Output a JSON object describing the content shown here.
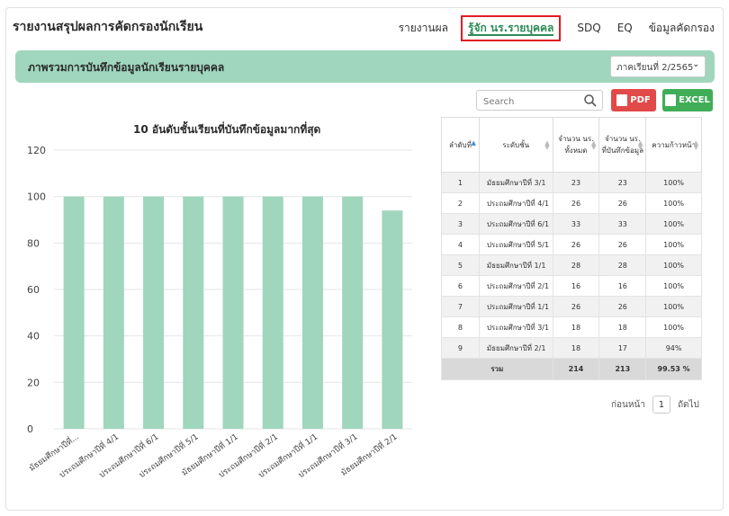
{
  "header": {
    "app_title": "รายงานสรุปผลการคัดกรองนักเรียน",
    "nav": [
      {
        "label": "รายงานผล",
        "active": false
      },
      {
        "label": "รู้จัก นร.รายบุคคล",
        "active": true
      },
      {
        "label": "SDQ",
        "active": false
      },
      {
        "label": "EQ",
        "active": false
      },
      {
        "label": "ข้อมูลคัดกรอง",
        "active": false
      }
    ]
  },
  "section": {
    "title": "ภาพรวมการบันทึกข้อมูลนักเรียนรายบุคคล",
    "term_select": "ภาคเรียนที่ 2/2565"
  },
  "toolbar": {
    "search_placeholder": "Search",
    "pdf_label": "PDF",
    "excel_label": "EXCEL"
  },
  "chart_data": {
    "type": "bar",
    "title": "10 อันดับชั้นเรียนที่บันทึกข้อมูลมากที่สุด",
    "categories": [
      "มัธยมศึกษาปีที่...",
      "ประถมศึกษาปีที่ 4/1",
      "ประถมศึกษาปีที่ 6/1",
      "ประถมศึกษาปีที่ 5/1",
      "มัธยมศึกษาปีที่ 1/1",
      "ประถมศึกษาปีที่ 2/1",
      "ประถมศึกษาปีที่ 1/1",
      "ประถมศึกษาปีที่ 3/1",
      "มัธยมศึกษาปีที่ 2/1"
    ],
    "values": [
      100,
      100,
      100,
      100,
      100,
      100,
      100,
      100,
      94
    ],
    "ylim": [
      0,
      120
    ],
    "yticks": [
      0,
      20,
      40,
      60,
      80,
      100,
      120
    ],
    "color": "#9fd6bd",
    "grid": true
  },
  "table": {
    "columns": [
      "ลำดับที่",
      "ระดับชั้น",
      "จำนวน นร. ทั้งหมด",
      "จำนวน นร. ที่บันทึกข้อมูล",
      "ความก้าวหน้า"
    ],
    "rows": [
      [
        "1",
        "มัธยมศึกษาปีที่ 3/1",
        "23",
        "23",
        "100%"
      ],
      [
        "2",
        "ประถมศึกษาปีที่ 4/1",
        "26",
        "26",
        "100%"
      ],
      [
        "3",
        "ประถมศึกษาปีที่ 6/1",
        "33",
        "33",
        "100%"
      ],
      [
        "4",
        "ประถมศึกษาปีที่ 5/1",
        "26",
        "26",
        "100%"
      ],
      [
        "5",
        "มัธยมศึกษาปีที่ 1/1",
        "28",
        "28",
        "100%"
      ],
      [
        "6",
        "ประถมศึกษาปีที่ 2/1",
        "16",
        "16",
        "100%"
      ],
      [
        "7",
        "ประถมศึกษาปีที่ 1/1",
        "26",
        "26",
        "100%"
      ],
      [
        "8",
        "ประถมศึกษาปีที่ 3/1",
        "18",
        "18",
        "100%"
      ],
      [
        "9",
        "มัธยมศึกษาปีที่ 2/1",
        "18",
        "17",
        "94%"
      ]
    ],
    "footer": {
      "label": "รวม",
      "total": "214",
      "recorded": "213",
      "progress": "99.53 %"
    }
  },
  "pagination": {
    "prev_label": "ก่อนหน้า",
    "current_page": "1",
    "next_label": "ถัดไป"
  },
  "colors": {
    "accent_green": "#9fd6bd",
    "active_nav": "#2e8b57",
    "highlight_border": "#e31b23",
    "pdf_red": "#e24a4a",
    "excel_green": "#3fae57"
  }
}
